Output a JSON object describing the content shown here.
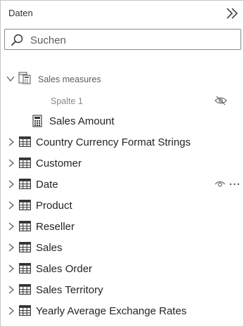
{
  "pane": {
    "title": "Daten",
    "collapse_icon": "double-chevron-right-icon"
  },
  "search": {
    "placeholder": "Suchen",
    "value": "",
    "icon": "search-icon"
  },
  "tree": {
    "measure_group": {
      "label": "Sales measures",
      "expanded": true,
      "icon": "measure-table-icon",
      "children": [
        {
          "label": "Spalte 1",
          "kind": "hidden-column",
          "status_icon": "hidden-eye-icon"
        },
        {
          "label": "Sales Amount",
          "kind": "measure",
          "icon": "calculator-icon"
        }
      ]
    },
    "tables": [
      {
        "label": "Country Currency Format Strings"
      },
      {
        "label": "Customer"
      },
      {
        "label": "Date",
        "hover": true,
        "actions": [
          "visibility-eye-icon",
          "more-options-icon"
        ]
      },
      {
        "label": "Product"
      },
      {
        "label": "Reseller"
      },
      {
        "label": "Sales"
      },
      {
        "label": "Sales Order"
      },
      {
        "label": "Sales Territory"
      },
      {
        "label": "Yearly Average Exchange Rates"
      }
    ]
  },
  "colors": {
    "text": "#252423",
    "muted": "#605e5c",
    "hidden": "#8a8886",
    "border": "#c8c6c4",
    "icon": "#323130"
  }
}
